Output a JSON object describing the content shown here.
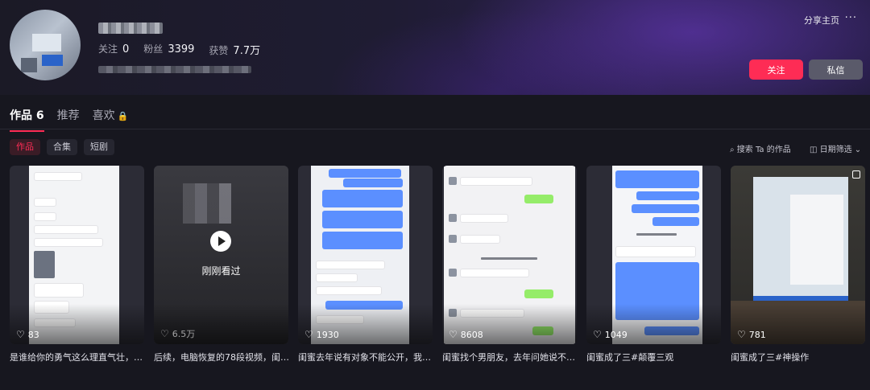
{
  "profile": {
    "stats": [
      {
        "label": "关注",
        "value": "0"
      },
      {
        "label": "粉丝",
        "value": "3399"
      },
      {
        "label": "获赞",
        "value": "7.7万"
      }
    ],
    "share_label": "分享主页",
    "more_label": "···",
    "follow_label": "关注",
    "message_label": "私信"
  },
  "tabs": [
    {
      "label": "作品 6"
    },
    {
      "label": "推荐"
    },
    {
      "label": "喜欢"
    }
  ],
  "filters": {
    "chips": [
      "作品",
      "合集",
      "短剧"
    ],
    "search_label": "⌕ 搜索 Ta 的作品",
    "date_label": "◫ 日期筛选 ⌄"
  },
  "overlay": {
    "watched_label": "刚刚看过"
  },
  "videos": [
    {
      "likes": "83",
      "caption": "是谁给你的勇气这么理直气壮，…"
    },
    {
      "likes": "6.5万",
      "caption": "后续，电脑恢复的78段视频，闺…"
    },
    {
      "likes": "1930",
      "caption": "闺蜜去年说有对象不能公开，我…"
    },
    {
      "likes": "8608",
      "caption": "闺蜜找个男朋友，去年问她说不…"
    },
    {
      "likes": "1049",
      "caption": "闺蜜成了三#颠覆三观"
    },
    {
      "likes": "781",
      "caption": "闺蜜成了三#神操作"
    }
  ],
  "colors": {
    "accent": "#fe2c55",
    "background": "#17171f"
  }
}
